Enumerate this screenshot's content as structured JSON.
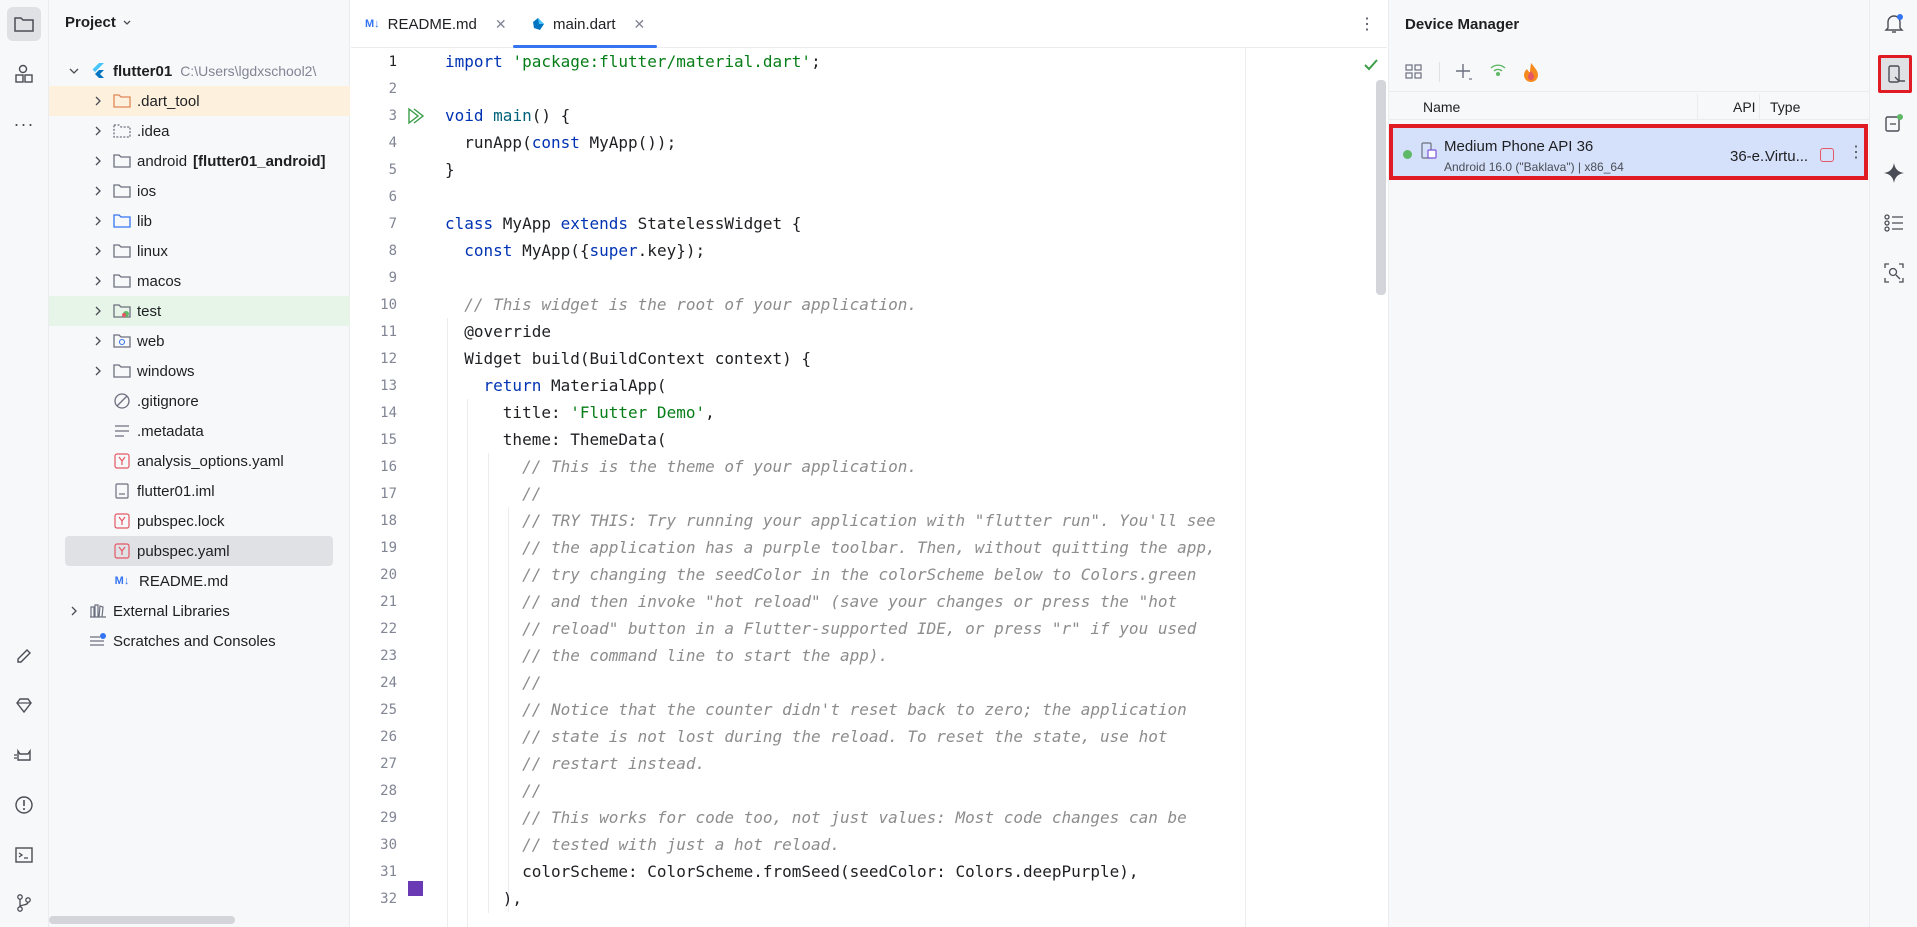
{
  "project_panel": {
    "title": "Project",
    "tree": [
      {
        "label": "flutter01",
        "hint": "C:\\Users\\lgdxschool2\\",
        "icon": "flutter-icon"
      },
      {
        "label": ".dart_tool",
        "icon": "folder-icon"
      },
      {
        "label": ".idea",
        "icon": "folder-icon"
      },
      {
        "label": "android",
        "suffix": "[flutter01_android]",
        "icon": "folder-icon"
      },
      {
        "label": "ios",
        "icon": "folder-icon"
      },
      {
        "label": "lib",
        "icon": "folder-icon"
      },
      {
        "label": "linux",
        "icon": "folder-icon"
      },
      {
        "label": "macos",
        "icon": "folder-icon"
      },
      {
        "label": "test",
        "icon": "folder-icon"
      },
      {
        "label": "web",
        "icon": "folder-icon"
      },
      {
        "label": "windows",
        "icon": "folder-icon"
      },
      {
        "label": ".gitignore",
        "icon": "ignore-file-icon"
      },
      {
        "label": ".metadata",
        "icon": "text-file-icon"
      },
      {
        "label": "analysis_options.yaml",
        "icon": "yaml-file-icon"
      },
      {
        "label": "flutter01.iml",
        "icon": "iml-file-icon"
      },
      {
        "label": "pubspec.lock",
        "icon": "yaml-file-icon"
      },
      {
        "label": "pubspec.yaml",
        "icon": "yaml-file-icon"
      },
      {
        "label": "README.md",
        "icon": "markdown-file-icon"
      },
      {
        "label": "External Libraries",
        "icon": "library-icon"
      },
      {
        "label": "Scratches and Consoles",
        "icon": "scratches-icon"
      }
    ]
  },
  "editor": {
    "tabs": [
      {
        "label": "README.md",
        "icon": "markdown-file-icon",
        "active": false
      },
      {
        "label": "main.dart",
        "icon": "dart-file-icon",
        "active": true
      }
    ],
    "line_numbers": [
      "1",
      "2",
      "3",
      "4",
      "5",
      "6",
      "7",
      "8",
      "9",
      "10",
      "11",
      "12",
      "13",
      "14",
      "15",
      "16",
      "17",
      "18",
      "19",
      "20",
      "21",
      "22",
      "23",
      "24",
      "25",
      "26",
      "27",
      "28",
      "29",
      "30",
      "31",
      "32"
    ],
    "code": {
      "l1a": "import ",
      "l1b": "'package:flutter/material.dart'",
      "l1c": ";",
      "l3a": "void ",
      "l3b": "main",
      "l3c": "() {",
      "l4a": "  runApp(",
      "l4b": "const ",
      "l4c": "MyApp());",
      "l5": "}",
      "l7a": "class ",
      "l7b": "MyApp ",
      "l7c": "extends ",
      "l7d": "StatelessWidget {",
      "l8a": "  ",
      "l8b": "const ",
      "l8c": "MyApp({",
      "l8d": "super",
      "l8e": ".key});",
      "l10": "  // This widget is the root of your application.",
      "l11": "  @override",
      "l12": "  Widget build(BuildContext context) {",
      "l13a": "    ",
      "l13b": "return ",
      "l13c": "MaterialApp(",
      "l14a": "      title: ",
      "l14b": "'Flutter Demo'",
      "l14c": ",",
      "l15": "      theme: ThemeData(",
      "l16": "        // This is the theme of your application.",
      "l17": "        //",
      "l18": "        // TRY THIS: Try running your application with \"flutter run\". You'll see",
      "l19": "        // the application has a purple toolbar. Then, without quitting the app,",
      "l20": "        // try changing the seedColor in the colorScheme below to Colors.green",
      "l21": "        // and then invoke \"hot reload\" (save your changes or press the \"hot",
      "l22": "        // reload\" button in a Flutter-supported IDE, or press \"r\" if you used",
      "l23": "        // the command line to start the app).",
      "l24": "        //",
      "l25": "        // Notice that the counter didn't reset back to zero; the application",
      "l26": "        // state is not lost during the reload. To reset the state, use hot",
      "l27": "        // restart instead.",
      "l28": "        //",
      "l29": "        // This works for code too, not just values: Most code changes can be",
      "l30": "        // tested with just a hot reload.",
      "l31": "        colorScheme: ColorScheme.fromSeed(seedColor: Colors.deepPurple),",
      "l32": "      ),"
    }
  },
  "device_manager": {
    "title": "Device Manager",
    "columns": {
      "name": "Name",
      "api": "API",
      "type": "Type"
    },
    "device": {
      "name": "Medium Phone API 36",
      "details": "Android 16.0 (\"Baklava\") | x86_64",
      "api": "36-e..",
      "type": "Virtu...",
      "status": "running"
    }
  },
  "colors": {
    "accent": "#3574f0",
    "highlight_red": "#e01b24",
    "selected_row": "#d5e0fa",
    "running_dot": "#5fb865",
    "color_swatch": "#6a3ab5"
  }
}
